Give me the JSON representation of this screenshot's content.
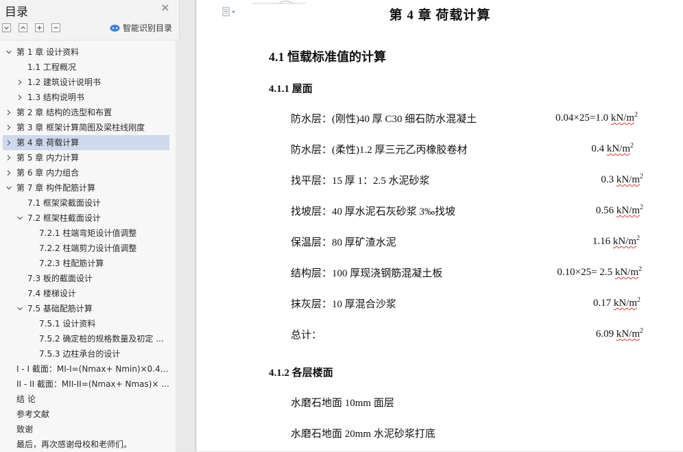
{
  "sidebar": {
    "title": "目录",
    "smart_toc_label": "智能识别目录",
    "toc": [
      {
        "label": "第 1 章  设计资料",
        "expanded": true
      },
      {
        "label": "1.1  工程概况"
      },
      {
        "label": "1.2  建筑设计说明书",
        "expanded": false
      },
      {
        "label": "1.3  结构说明书",
        "expanded": false
      },
      {
        "label": "第 2 章  结构的选型和布置",
        "expanded": false
      },
      {
        "label": "第 3 章  框架计算简图及梁柱线刚度",
        "expanded": false
      },
      {
        "label": "第 4 章  荷载计算",
        "expanded": false,
        "selected": true
      },
      {
        "label": "第 5 章  内力计算",
        "expanded": false
      },
      {
        "label": "第 6 章  内力组合",
        "expanded": false
      },
      {
        "label": "第 7 章  构件配筋计算",
        "expanded": true
      },
      {
        "label": "7.1  框架梁截面设计"
      },
      {
        "label": "7.2  框架柱截面设计",
        "expanded": true
      },
      {
        "label": "7.2.1  柱端弯矩设计值调整"
      },
      {
        "label": "7.2.2  柱端剪力设计值调整"
      },
      {
        "label": "7.2.3  柱配筋计算"
      },
      {
        "label": "7.3  板的截面设计"
      },
      {
        "label": "7.4  楼梯设计"
      },
      {
        "label": "7.5  基础配筋计算",
        "expanded": true
      },
      {
        "label": "7.5.1  设计资料"
      },
      {
        "label": "7.5.2  确定桩的规格数量及初定 ..."
      },
      {
        "label": "7.5.3  边柱承台的设计"
      },
      {
        "label": "I - I 截面：MI-I=(Nmax+ Nmin)×0.4 ..."
      },
      {
        "label": "II - II 截面：MII-II=(Nmax+ Nmas)× ..."
      },
      {
        "label": "结    论"
      },
      {
        "label": "参考文献"
      },
      {
        "label": "致谢"
      },
      {
        "label": "最后，再次感谢母校和老师们。"
      }
    ]
  },
  "document": {
    "chapter_title": "第 4 章  荷载计算",
    "section_title": "4.1  恒载标准值的计算",
    "subsection_roof": "4.1.1  屋面",
    "roof_rows": [
      {
        "label": "防水层：(刚性)40 厚 C30 细石防水混凝土",
        "value": "0.04×25=1.0",
        "unit": "kN/m",
        "exp": "2"
      },
      {
        "label": "防水层：(柔性)1.2 厚三元乙丙橡胶卷材",
        "value": "0.4",
        "unit": "kN/m",
        "exp": "2"
      },
      {
        "label": "找平层：15 厚 1：2.5 水泥砂浆",
        "value": "0.3",
        "unit": "kN/m",
        "exp": "2"
      },
      {
        "label": "找坡层：40 厚水泥石灰砂浆 3‰找坡",
        "value": "0.56",
        "unit": "kN/m",
        "exp": "2"
      },
      {
        "label": "保温层：80 厚矿渣水泥",
        "value": "1.16",
        "unit": "kN/m",
        "exp": "2"
      },
      {
        "label": "结构层：100 厚现浇钢筋混凝土板",
        "value": "0.10×25= 2.5",
        "unit": "kN/m",
        "exp": "2"
      },
      {
        "label": "抹灰层：10 厚混合沙浆",
        "value": "0.17",
        "unit": "kN/m",
        "exp": "2"
      },
      {
        "label": "总计：",
        "value": "6.09",
        "unit": "kN/m",
        "exp": "2"
      }
    ],
    "subsection_floor": "4.1.2  各层楼面",
    "floor_rows": [
      {
        "label": "水磨石地面 10mm 面层"
      },
      {
        "label": "水磨石地面 20mm 水泥砂浆打底"
      }
    ]
  }
}
